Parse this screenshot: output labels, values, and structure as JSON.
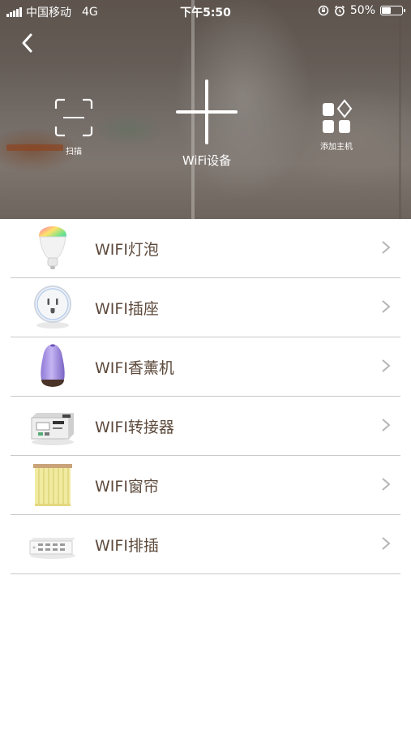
{
  "status_bar": {
    "carrier": "中国移动",
    "network": "4G",
    "time": "下午5:50",
    "battery_text": "50%",
    "battery_level": 0.5
  },
  "header": {
    "actions": {
      "scan_label": "扫描",
      "wifi_label": "WiFi设备",
      "host_label": "添加主机"
    }
  },
  "devices": [
    {
      "label": "WIFI灯泡",
      "icon": "bulb-icon"
    },
    {
      "label": "WIFI插座",
      "icon": "socket-icon"
    },
    {
      "label": "WIFI香薰机",
      "icon": "aroma-diffuser-icon"
    },
    {
      "label": "WIFI转接器",
      "icon": "adapter-icon"
    },
    {
      "label": "WIFI窗帘",
      "icon": "curtain-icon"
    },
    {
      "label": "WIFI排插",
      "icon": "power-strip-icon"
    }
  ],
  "colors": {
    "item_text": "#5d4a3c",
    "divider": "#c9c9c9",
    "chevron": "#b5b5b5"
  }
}
